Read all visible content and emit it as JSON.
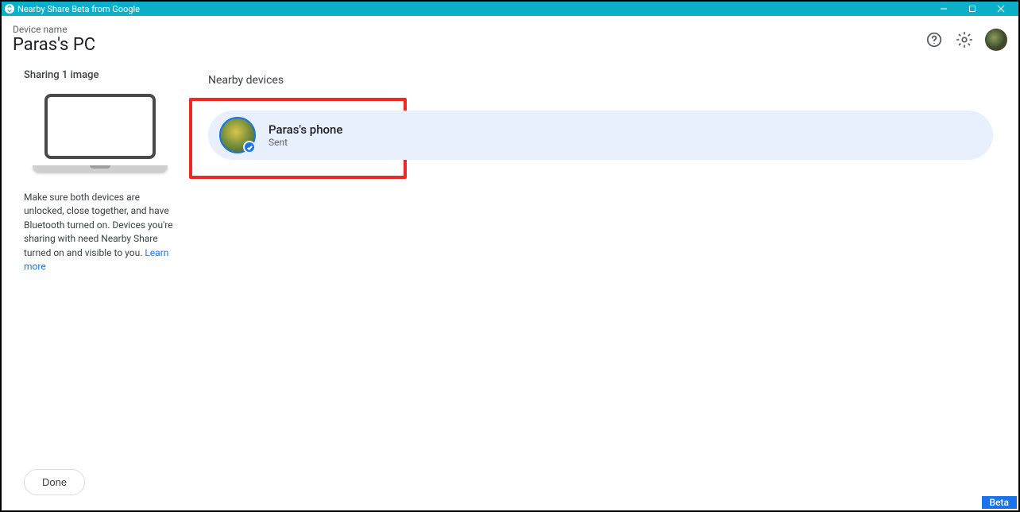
{
  "window": {
    "title": "Nearby Share Beta from Google"
  },
  "header": {
    "device_label": "Device name",
    "device_name": "Paras's PC"
  },
  "sidebar": {
    "sharing_title": "Sharing 1 image",
    "help_text": "Make sure both devices are unlocked, close together, and have Bluetooth turned on. Devices you're sharing with need Nearby Share turned on and visible to you. ",
    "learn_more": "Learn more",
    "done_label": "Done"
  },
  "main": {
    "section_title": "Nearby devices",
    "devices": [
      {
        "name": "Paras's phone",
        "status": "Sent"
      }
    ]
  },
  "footer": {
    "beta_label": "Beta"
  }
}
